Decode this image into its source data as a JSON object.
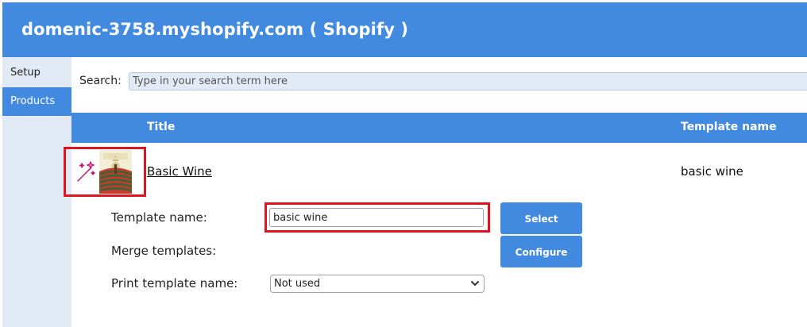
{
  "header": {
    "title": "domenic-3758.myshopify.com ( Shopify )",
    "background_color": "#418ae0"
  },
  "sidebar": {
    "items": [
      {
        "label": "Setup",
        "active": false
      },
      {
        "label": "Products",
        "active": true
      }
    ]
  },
  "search": {
    "label": "Search:",
    "placeholder": "Type in your search term here",
    "value": ""
  },
  "table": {
    "columns": [
      "Title",
      "Template name"
    ],
    "rows": [
      {
        "icon": "magic-wand-icon",
        "thumbnail": "wine-label-thumbnail",
        "title": "Basic Wine",
        "template_name": "basic wine"
      }
    ]
  },
  "details": {
    "template_name_label": "Template name:",
    "template_name_value": "basic wine",
    "merge_templates_label": "Merge templates:",
    "print_template_label": "Print template name:",
    "print_template_selected": "Not used",
    "select_button": "Select",
    "configure_button": "Configure"
  },
  "colors": {
    "accent": "#418ae0",
    "sidebar_bg": "#e2eaf5",
    "highlight": "#e0141e",
    "wand": "#c2187a"
  }
}
